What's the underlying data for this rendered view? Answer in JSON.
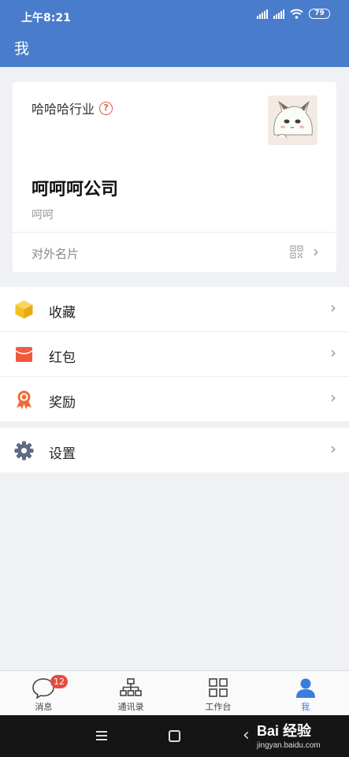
{
  "status_bar": {
    "time": "上午8:21",
    "battery": "79"
  },
  "header": {
    "title": "我"
  },
  "profile": {
    "industry": "哈哈哈行业",
    "help_symbol": "?",
    "company": "呵呵呵公司",
    "subtitle": "呵呵",
    "business_card_label": "对外名片",
    "avatar_icon": "cat-avatar-icon"
  },
  "menu": {
    "group1": [
      {
        "label": "收藏",
        "icon": "favorites-box-icon",
        "color": "#f5c026"
      },
      {
        "label": "红包",
        "icon": "red-envelope-icon",
        "color": "#f15a3e"
      },
      {
        "label": "奖励",
        "icon": "award-medal-icon",
        "color": "#f06a3a"
      }
    ],
    "group2": [
      {
        "label": "设置",
        "icon": "gear-icon",
        "color": "#5e6b80"
      }
    ],
    "chevron": "›"
  },
  "tabbar": {
    "tabs": [
      {
        "label": "消息",
        "icon": "chat-bubble-icon",
        "badge": "12"
      },
      {
        "label": "通讯录",
        "icon": "org-chart-icon"
      },
      {
        "label": "工作台",
        "icon": "grid-icon"
      },
      {
        "label": "我",
        "icon": "person-icon",
        "active": true
      }
    ]
  },
  "watermark": {
    "main": "Bai 经验",
    "sub": "jingyan.baidu.com"
  },
  "colors": {
    "header": "#4a7ccc",
    "accent": "#3b7ddd",
    "badge": "#e84a3f",
    "background": "#eff1f4"
  }
}
